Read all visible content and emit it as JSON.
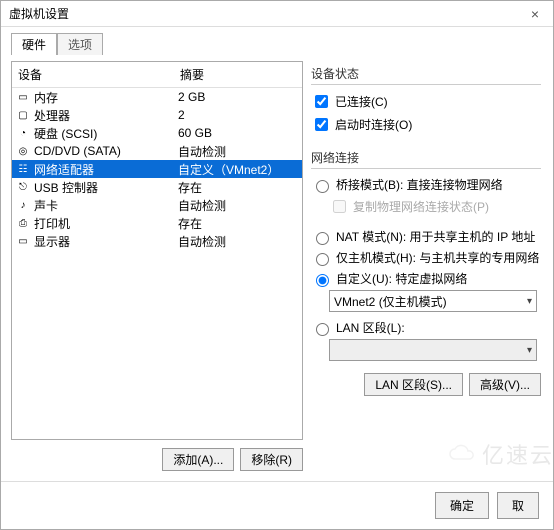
{
  "window": {
    "title": "虚拟机设置",
    "close": "×"
  },
  "tabs": {
    "hardware": "硬件",
    "options": "选项"
  },
  "device_table": {
    "col_name": "设备",
    "col_summary": "摘要",
    "rows": [
      {
        "icon": "memory-icon",
        "glyph": "▭",
        "name": "内存",
        "summary": "2 GB",
        "selected": false
      },
      {
        "icon": "cpu-icon",
        "glyph": "▢",
        "name": "处理器",
        "summary": "2",
        "selected": false
      },
      {
        "icon": "disk-icon",
        "glyph": "◔",
        "name": "硬盘 (SCSI)",
        "summary": "60 GB",
        "selected": false
      },
      {
        "icon": "cdrom-icon",
        "glyph": "◎",
        "name": "CD/DVD (SATA)",
        "summary": "自动检测",
        "selected": false
      },
      {
        "icon": "network-icon",
        "glyph": "☷",
        "name": "网络适配器",
        "summary": "自定义（VMnet2）",
        "selected": true
      },
      {
        "icon": "usb-icon",
        "glyph": "⎋",
        "name": "USB 控制器",
        "summary": "存在",
        "selected": false
      },
      {
        "icon": "sound-icon",
        "glyph": "♪",
        "name": "声卡",
        "summary": "自动检测",
        "selected": false
      },
      {
        "icon": "printer-icon",
        "glyph": "⎙",
        "name": "打印机",
        "summary": "存在",
        "selected": false
      },
      {
        "icon": "display-icon",
        "glyph": "▭",
        "name": "显示器",
        "summary": "自动检测",
        "selected": false
      }
    ]
  },
  "left_buttons": {
    "add": "添加(A)...",
    "remove": "移除(R)"
  },
  "status_group": {
    "title": "设备状态",
    "connected": "已连接(C)",
    "connect_on": "启动时连接(O)"
  },
  "net_group": {
    "title": "网络连接",
    "bridged": "桥接模式(B): 直接连接物理网络",
    "replicate": "复制物理网络连接状态(P)",
    "nat": "NAT 模式(N): 用于共享主机的 IP 地址",
    "hostonly": "仅主机模式(H): 与主机共享的专用网络",
    "custom": "自定义(U): 特定虚拟网络",
    "custom_value": "VMnet2 (仅主机模式)",
    "lan": "LAN 区段(L):",
    "lan_value": ""
  },
  "right_buttons": {
    "lan_seg": "LAN 区段(S)...",
    "advanced": "高级(V)..."
  },
  "footer": {
    "ok": "确定",
    "cancel": "取"
  },
  "watermark": "亿速云"
}
